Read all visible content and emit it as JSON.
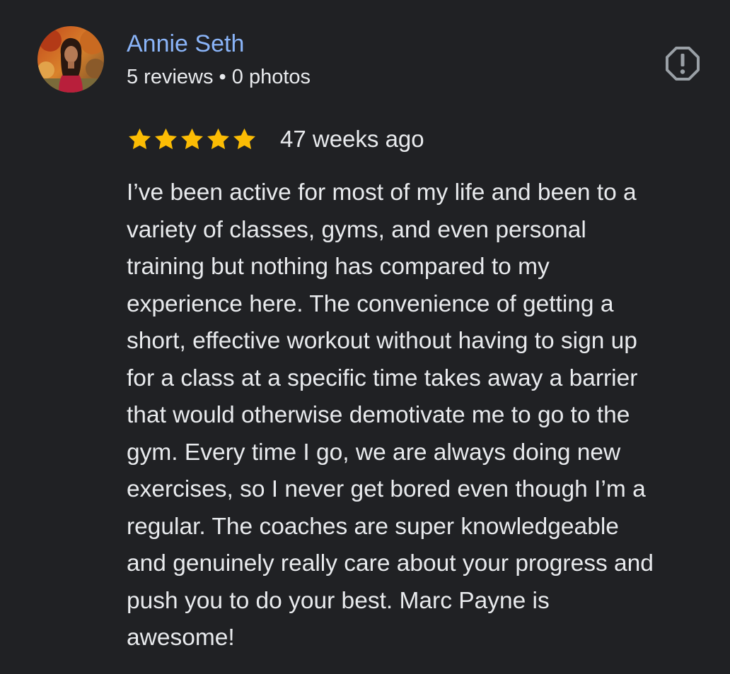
{
  "review": {
    "author": {
      "name": "Annie Seth",
      "meta": "5 reviews • 0 photos",
      "avatar_icon": "profile-photo"
    },
    "report_icon": "report-flag-icon",
    "rating": {
      "stars": 5,
      "max": 5,
      "star_color": "#fbbc04"
    },
    "time_ago": "47 weeks ago",
    "text": "I’ve been active for most of my life and been to a\nvariety of classes, gyms, and even personal\ntraining but nothing has compared to my\nexperience here. The convenience of getting a\nshort, effective workout without having to sign up\nfor a class at a specific time takes away a barrier\nthat would otherwise demotivate me to go to the\ngym. Every time I go, we are always doing new\nexercises, so I never get bored even though I’m a\nregular. The coaches are super knowledgeable\nand genuinely really care about your progress and\npush you to do your best. Marc Payne is\nawesome!"
  },
  "colors": {
    "background": "#202124",
    "link": "#8ab4f8",
    "text": "#e8eaed",
    "icon": "#9aa0a6"
  }
}
